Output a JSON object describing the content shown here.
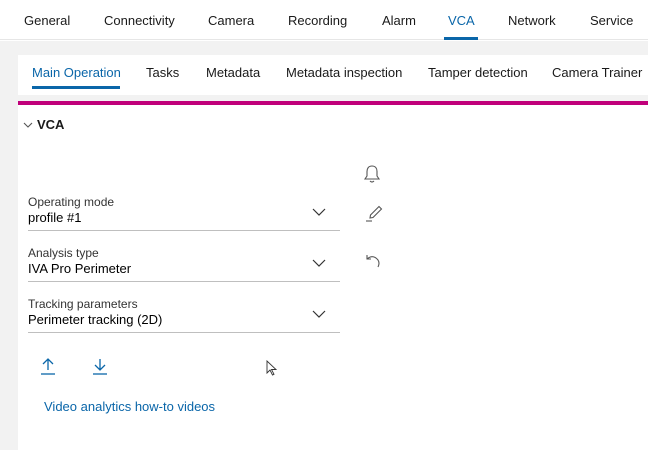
{
  "top_nav": {
    "tabs": [
      "General",
      "Connectivity",
      "Camera",
      "Recording",
      "Alarm",
      "VCA",
      "Network",
      "Service"
    ],
    "active": "VCA"
  },
  "sub_nav": {
    "tabs": [
      "Main Operation",
      "Tasks",
      "Metadata",
      "Metadata inspection",
      "Tamper detection",
      "Camera Trainer"
    ],
    "active": "Main Operation"
  },
  "section": {
    "title": "VCA"
  },
  "fields": {
    "operating_mode": {
      "label": "Operating mode",
      "value": "profile #1"
    },
    "analysis_type": {
      "label": "Analysis type",
      "value": "IVA Pro Perimeter"
    },
    "tracking_parameters": {
      "label": "Tracking parameters",
      "value": "Perimeter tracking (2D)"
    }
  },
  "icons": {
    "alarm": "bell-icon",
    "edit": "pencil-icon",
    "undo": "undo-icon",
    "upload": "upload-icon",
    "download": "download-icon"
  },
  "link": {
    "label": "Video analytics how-to videos"
  },
  "colors": {
    "accent": "#0a66a9",
    "magenta": "#c0007a"
  }
}
